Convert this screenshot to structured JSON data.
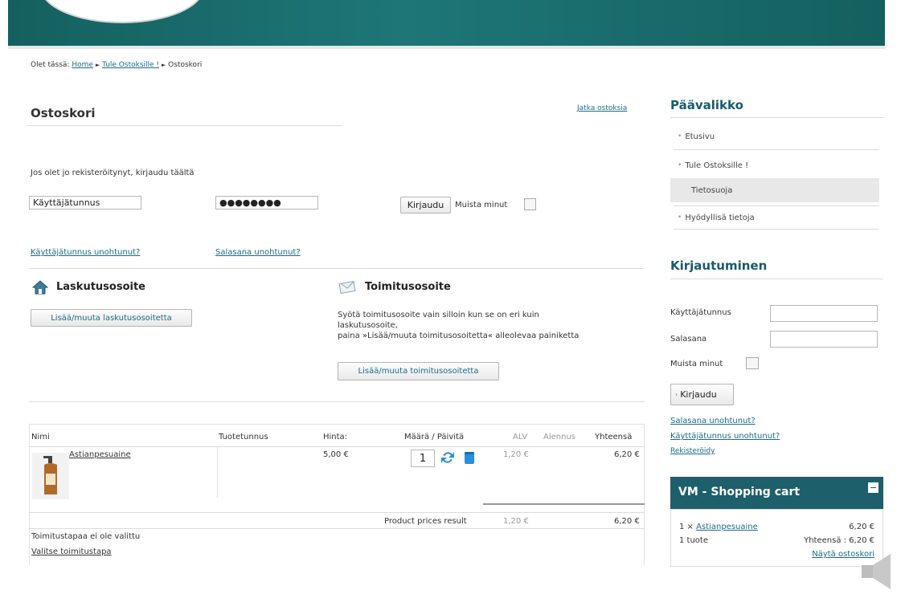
{
  "breadcrumb": {
    "prefix": "Olet tässä:",
    "home": "Home",
    "shop": "Tule Ostoksille !",
    "sep": "►",
    "current": "Ostoskori"
  },
  "main": {
    "title": "Ostoskori",
    "continue_link": "Jatka ostoksia",
    "login_prompt": "Jos olet jo rekisteröitynyt, kirjaudu täältä",
    "username_value": "Käyttäjätunnus",
    "password_value": "●●●●●●●●",
    "login_button": "Kirjaudu",
    "remember_label": "Muista minut",
    "forgot_username": "Käyttäjätunnus unohtunut?",
    "forgot_password": "Salasana unohtunut?"
  },
  "billing": {
    "title": "Laskutusosoite",
    "button": "Lisää/muuta laskutusosoitetta"
  },
  "shipping": {
    "title": "Toimitusosoite",
    "text1": "Syötä toimitusosoite vain silloin kun se on eri kuin",
    "text2": "laskutusosoite,",
    "text3": "paina »Lisää/muuta toimitusosoitetta« alleolevaa painiketta",
    "button": "Lisää/muuta toimitusosoitetta"
  },
  "cart_table": {
    "headers": {
      "name": "Nimi",
      "sku": "Tuotetunnus",
      "price": "Hinta:",
      "qty": "Määrä / Päivitä",
      "vat": "ALV",
      "discount": "Alennus",
      "total": "Yhteensä"
    },
    "row": {
      "name": "Astianpesuaine",
      "price": "5,00 €",
      "qty": "1",
      "vat": "1,20 €",
      "total": "6,20 €"
    },
    "summary": {
      "label": "Product prices result",
      "vat": "1,20 €",
      "total": "6,20 €"
    },
    "shipping_note": "Toimitustapaa ei ole valittu",
    "choose_shipping": "Valitse toimitustapa"
  },
  "sidebar": {
    "main_menu_title": "Päävalikko",
    "menu_items": [
      "Etusivu",
      "Tule Ostoksille !",
      "Tietosuoja",
      "Hyödyllisä tietoja"
    ],
    "login_title": "Kirjautuminen",
    "username_label": "Käyttäjätunnus",
    "password_label": "Salasana",
    "remember_label": "Muista minut",
    "login_button": "Kirjaudu",
    "forgot_password": "Salasana unohtunut?",
    "forgot_username": "Käyttäjätunnus unohtunut?",
    "register": "Rekisteröidy"
  },
  "minicart": {
    "title": "VM - Shopping cart",
    "item_qty": "1 ×",
    "item_name": "Astianpesuaine",
    "item_price": "6,20 €",
    "count": "1 tuote",
    "total": "Yhteensä : 6,20 €",
    "show_cart": "Näytä ostoskori"
  },
  "colors": {
    "banner": "#1e7677",
    "link": "#1a6b8a",
    "cart_header": "#1d5f6b"
  },
  "icons": [
    "house-icon",
    "envelope-icon",
    "refresh-icon",
    "delete-icon",
    "speaker-icon",
    "minus-icon"
  ]
}
